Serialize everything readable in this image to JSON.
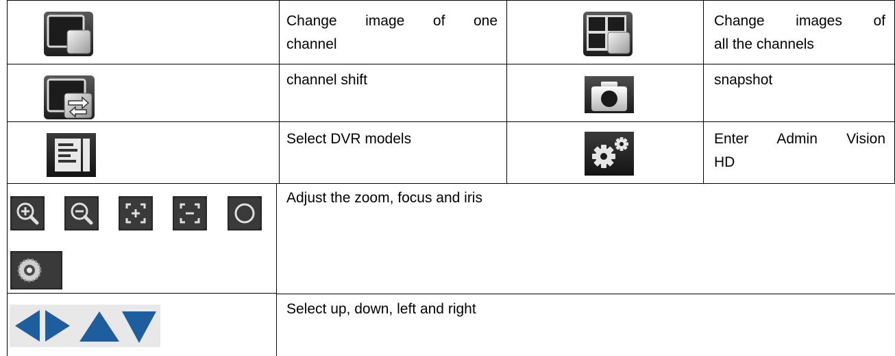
{
  "rows": [
    {
      "cells": [
        {
          "icon": "single-channel-image-icon",
          "text_line1": "Change  image  of  one",
          "text_line2": "channel"
        },
        {
          "icon": "all-channels-images-icon",
          "text_line1": "Change  images  of",
          "text_line2": "all the channels"
        }
      ]
    },
    {
      "cells": [
        {
          "icon": "channel-shift-icon",
          "text": "channel shift"
        },
        {
          "icon": "camera-icon",
          "text": "snapshot"
        }
      ]
    },
    {
      "cells": [
        {
          "icon": "dvr-models-list-icon",
          "text": "Select DVR models"
        },
        {
          "icon": "settings-gears-icon",
          "text_line1": "Enter  Admin  Vision",
          "text_line2": "HD"
        }
      ]
    },
    {
      "icons": [
        "zoom-in-icon",
        "zoom-out-icon",
        "focus-near-icon",
        "focus-far-icon",
        "iris-close-icon",
        "iris-open-icon"
      ],
      "text": "Adjust the zoom, focus and iris"
    },
    {
      "icons": [
        "arrow-left-icon",
        "arrow-right-icon",
        "arrow-up-icon",
        "arrow-down-icon"
      ],
      "text": "Select up, down, left and right"
    }
  ],
  "colors": {
    "border": "#000000",
    "arrow": "#1f5e9e",
    "icon_dark": "#2b2b2b"
  }
}
